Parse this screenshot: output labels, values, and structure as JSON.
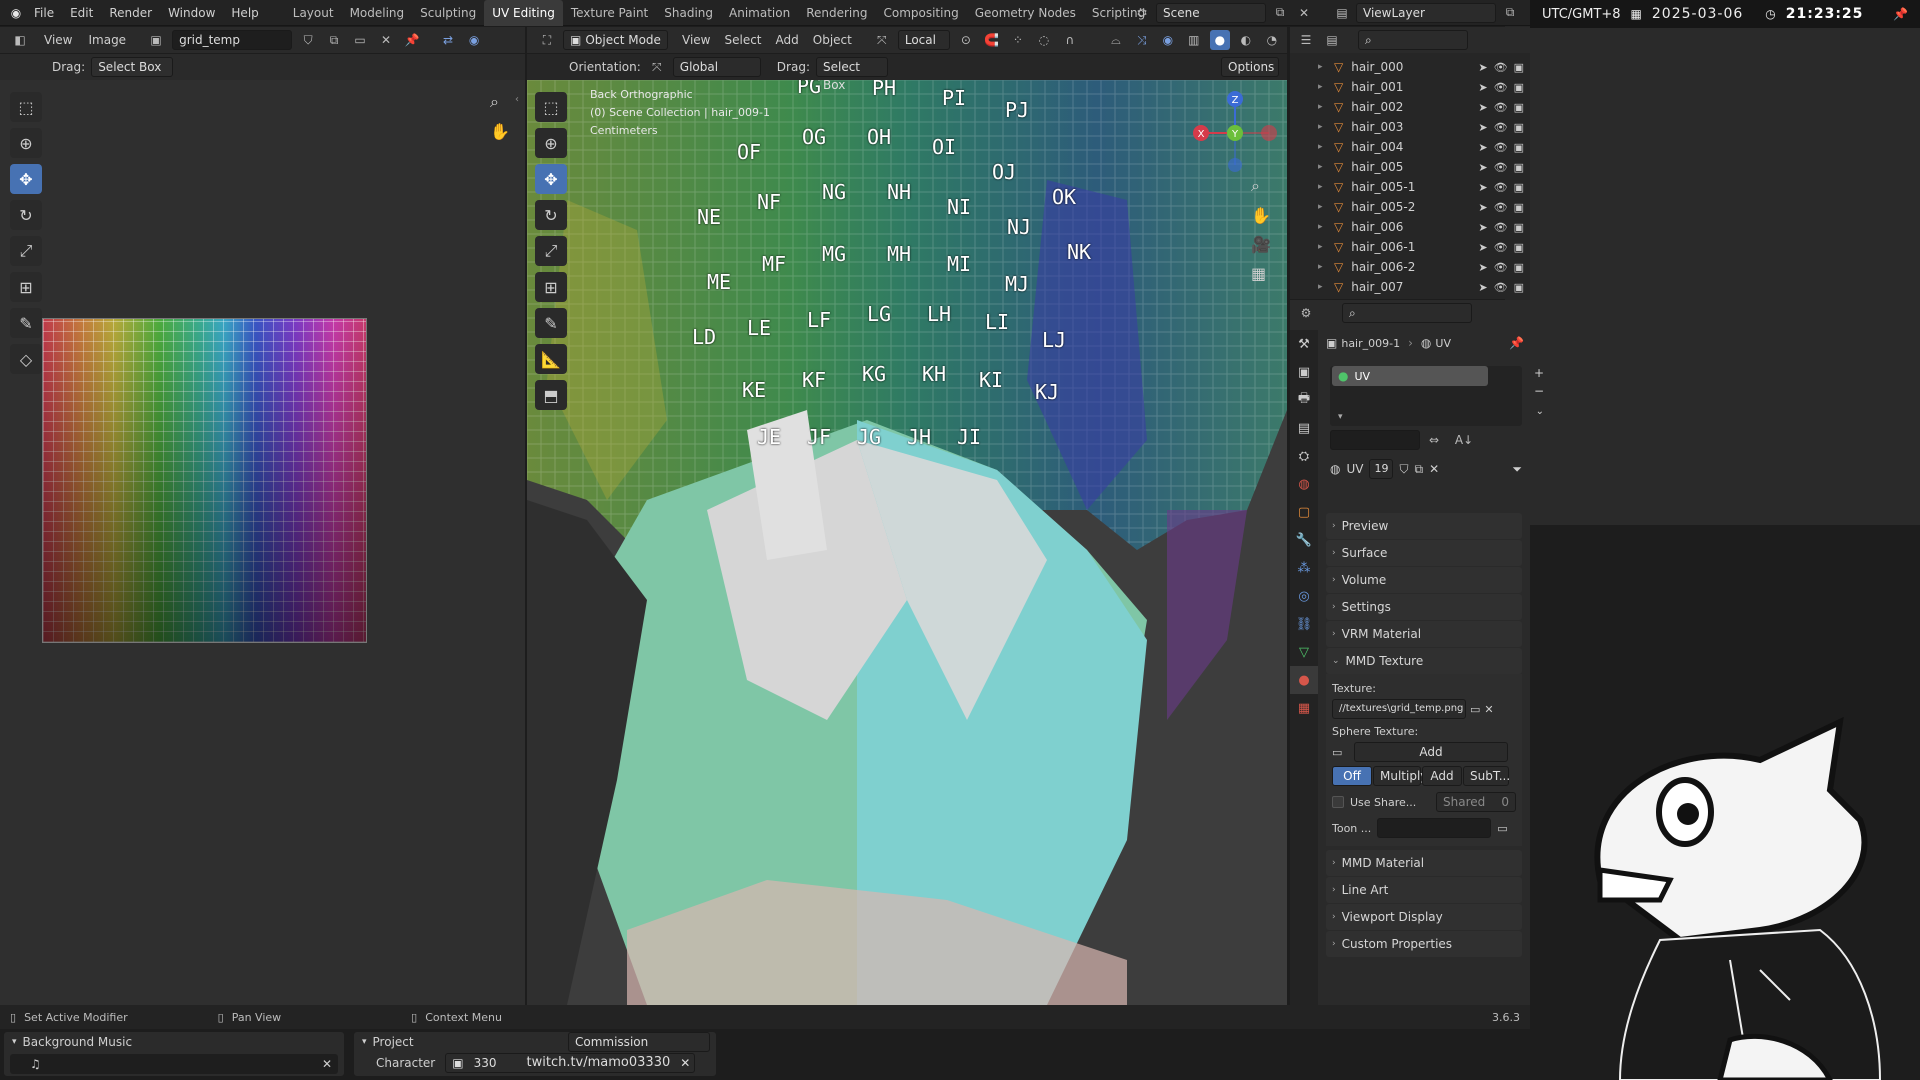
{
  "menu": [
    "File",
    "Edit",
    "Render",
    "Window",
    "Help"
  ],
  "workspaces": [
    "Layout",
    "Modeling",
    "Sculpting",
    "UV Editing",
    "Texture Paint",
    "Shading",
    "Animation",
    "Rendering",
    "Compositing",
    "Geometry Nodes",
    "Scripting"
  ],
  "active_workspace": "UV Editing",
  "scene": "Scene",
  "viewlayer": "ViewLayer",
  "uv_editor": {
    "menus": [
      "View",
      "Image"
    ],
    "image_name": "grid_temp",
    "drag_label": "Drag:",
    "drag_value": "Select Box"
  },
  "viewport": {
    "mode": "Object Mode",
    "menus": [
      "View",
      "Select",
      "Add",
      "Object"
    ],
    "orientation_label": "Orientation:",
    "orientation_value": "Global",
    "pivot": "Local",
    "drag_label": "Drag:",
    "drag_value": "Select Box",
    "options": "Options",
    "info_lines": [
      "Back Orthographic",
      "(0) Scene Collection | hair_009-1",
      "Centimeters"
    ],
    "gizmo": {
      "x": "X",
      "y": "Y",
      "z": "Z"
    },
    "uv_labels": [
      "PG",
      "PH",
      "PI",
      "PJ",
      "OF",
      "OG",
      "OH",
      "OI",
      "OJ",
      "OK",
      "NE",
      "NF",
      "NG",
      "NH",
      "NI",
      "NJ",
      "NK",
      "ME",
      "MF",
      "MG",
      "MH",
      "MI",
      "MJ",
      "LD",
      "LE",
      "LF",
      "LG",
      "LH",
      "LI",
      "LJ",
      "KE",
      "KF",
      "KG",
      "KH",
      "KI",
      "KJ",
      "JE",
      "JF",
      "JG",
      "JH",
      "JI"
    ]
  },
  "outliner": {
    "items": [
      "hair_000",
      "hair_001",
      "hair_002",
      "hair_003",
      "hair_004",
      "hair_005",
      "hair_005-1",
      "hair_005-2",
      "hair_006",
      "hair_006-1",
      "hair_006-2",
      "hair_007"
    ]
  },
  "properties": {
    "breadcrumb_object": "hair_009-1",
    "breadcrumb_material": "UV",
    "material_slot": "UV",
    "material_name": "UV",
    "material_users": "19",
    "panels_top": [
      "Preview",
      "Surface",
      "Volume",
      "Settings",
      "VRM Material"
    ],
    "mmd_texture": {
      "title": "MMD Texture",
      "texture_label": "Texture:",
      "texture_path": "//textures\\grid_temp.png",
      "sphere_label": "Sphere Texture:",
      "sphere_add": "Add",
      "sphere_modes": [
        "Off",
        "Multiply",
        "Add",
        "SubT..."
      ],
      "use_shared": "Use Share...",
      "shared": "Shared",
      "shared_value": "0",
      "toon": "Toon ..."
    },
    "panels_bottom": [
      "MMD Material",
      "Line Art",
      "Viewport Display",
      "Custom Properties"
    ]
  },
  "clock": {
    "timezone": "UTC/GMT+8",
    "date": "2025-03-06",
    "time": "21:23:25"
  },
  "status": {
    "left": "Set Active Modifier",
    "middle": "Pan View",
    "right": "Context Menu",
    "version": "3.6.3"
  },
  "bottom": {
    "bgm_title": "Background Music",
    "project_title": "Project",
    "project_value": "Commission",
    "character_label": "Character",
    "character_value": "330",
    "character_link": "twitch.tv/mamo03330"
  },
  "colors": {
    "accent": "#4772b3",
    "header": "#2a2a2a",
    "bg": "#1d1d1d"
  }
}
